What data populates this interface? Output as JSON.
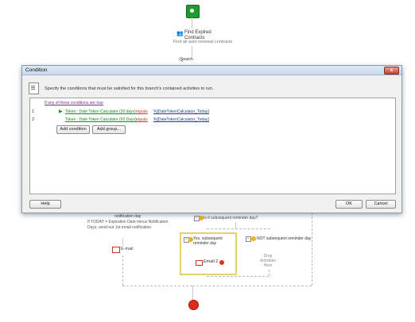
{
  "workflow": {
    "find_title": "Find Expired Contracts",
    "find_subtitle": "Find all auto renewal contracts",
    "search_label": "Search",
    "notification_day": "notification day",
    "notification_desc": "If TODAY = Expiration Date minus Notification Days, send out 1st email notification.",
    "email_label": "E-mail",
    "is_subsequent": "Is it subsequent reminder day?",
    "yes_label": "Yes, subsequent reminder day",
    "email2_label": "Email 2",
    "not_label": "NOT subsequent reminder day",
    "drop_label": "Drop Activities Here"
  },
  "dialog": {
    "title": "Condition",
    "close_label": "x",
    "instruction": "Specify the conditions that must be satisfied for this branch's contained activities to run.",
    "if_any": "If any of these conditions are true",
    "conditions": [
      {
        "num": "1",
        "token": "Token : Date Token Calculator (30 days)",
        "op": "equals",
        "value": "%[DateTokenCalculator_Today]"
      },
      {
        "num": "2",
        "token": "Token : Date Token Calculator (60 Days)",
        "op": "equals",
        "value": "%[DateTokenCalculator_Today]"
      }
    ],
    "add_condition": "Add condition",
    "add_group": "Add group...",
    "help": "Help",
    "ok": "OK",
    "cancel": "Cancel"
  },
  "colors": {
    "start_node": "#1f9a2f",
    "end_node": "#e02a1a",
    "token_link": "#1a8a1a",
    "operator_link": "#c0392b",
    "value_link": "#1e3d8f"
  }
}
